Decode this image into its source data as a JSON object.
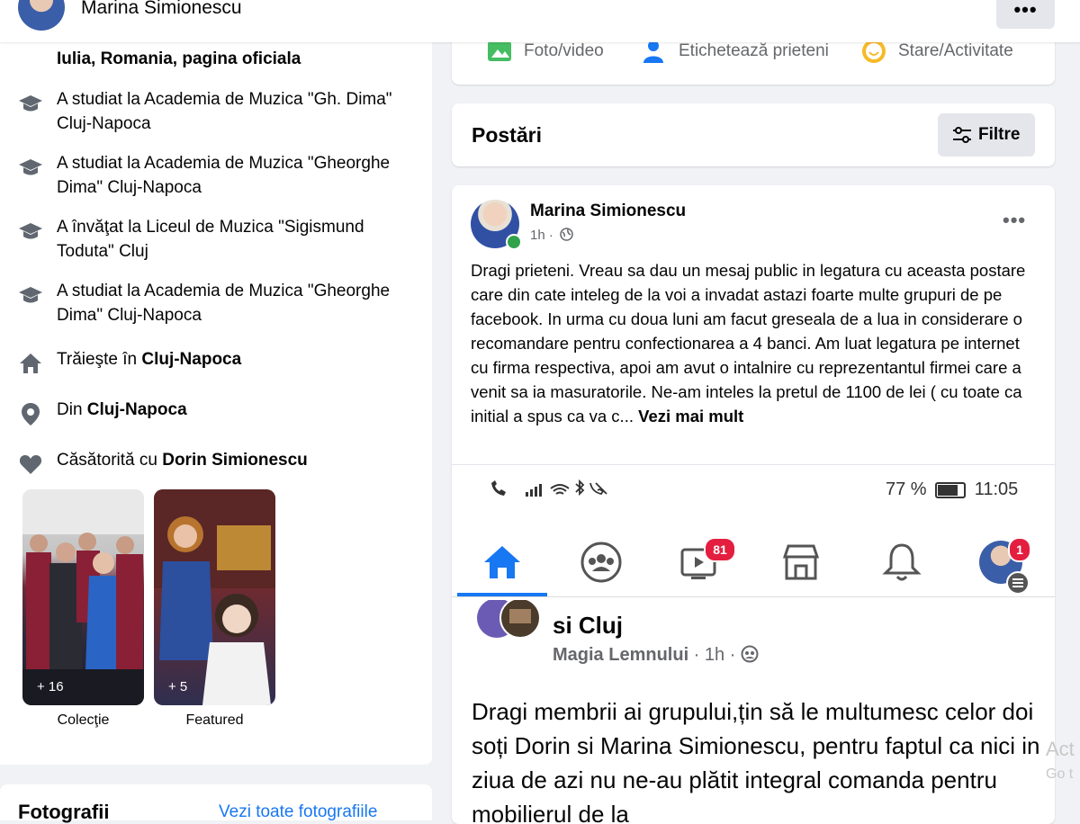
{
  "header": {
    "profile_name": "Marina Simionescu",
    "more_label": "•••"
  },
  "intro": {
    "page_line": "Iulia, Romania, pagina oficiala",
    "items": [
      {
        "icon": "graduation-cap-icon",
        "text": "A studiat la Academia de Muzica \"Gh. Dima\" Cluj-Napoca"
      },
      {
        "icon": "graduation-cap-icon",
        "text": "A studiat la Academia de Muzica \"Gheorghe Dima\" Cluj-Napoca"
      },
      {
        "icon": "graduation-cap-icon",
        "text": "A învăţat la Liceul de Muzica \"Sigismund Toduta\" Cluj"
      },
      {
        "icon": "graduation-cap-icon",
        "text": "A studiat la Academia de Muzica \"Gheorghe Dima\" Cluj-Napoca"
      }
    ],
    "lives_prefix": "Trăieşte în ",
    "lives_place": "Cluj-Napoca",
    "from_prefix": "Din ",
    "from_place": "Cluj-Napoca",
    "married_prefix": "Căsătorită cu ",
    "married_name": "Dorin Simionescu"
  },
  "featured": [
    {
      "label": "Colecţie",
      "count": "+ 16"
    },
    {
      "label": "Featured",
      "count": "+ 5"
    }
  ],
  "bottom": {
    "title": "Fotografii",
    "link": "Vezi toate fotografiile"
  },
  "composer": {
    "photo_label": "Foto/video",
    "tag_label": "Etichetează prieteni",
    "feeling_label": "Stare/Activitate"
  },
  "posts_header": {
    "title": "Postări",
    "filter_label": "Filtre"
  },
  "post": {
    "author": "Marina Simionescu",
    "time": "1h ·",
    "more": "•••",
    "text": "Dragi prieteni. Vreau sa dau un mesaj public in legatura cu aceasta postare care din cate inteleg de la voi a invadat astazi foarte multe grupuri de pe facebook. In urma cu doua luni am facut greseala de a lua in considerare o recomandare pentru confectionarea a 4 banci. Am luat legatura pe internet cu firma respectiva, apoi am avut o intalnire cu reprezentantul firmei care a venit sa ia masuratorile. Ne-am inteles la pretul de 1100 de lei ( cu toate ca initial a spus ca va c... ",
    "see_more": "Vezi mai mult"
  },
  "screenshot": {
    "battery": "77 %",
    "clock": "11:05",
    "video_badge": "81",
    "profile_badge": "1",
    "group_title": "si Cluj",
    "group_name": "Magia Lemnului",
    "group_time": " · 1h · ",
    "group_text": "Dragi membrii ai grupului,țin să le multumesc celor doi soți Dorin si Marina Simionescu, pentru faptul ca nici in ziua de azi nu ne-au plătit integral comanda pentru mobilierul de la"
  },
  "watermark": {
    "line1": "Act",
    "line2": "Go t"
  }
}
